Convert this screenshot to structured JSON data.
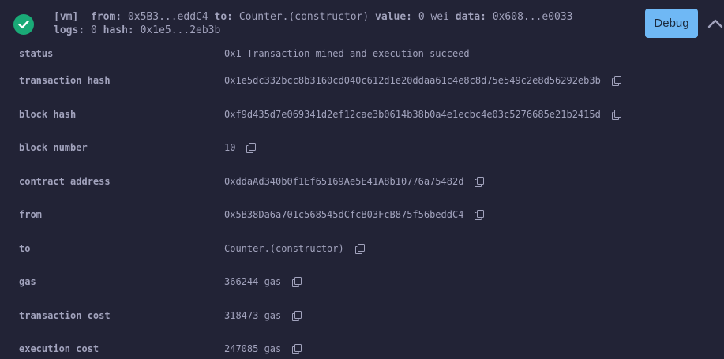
{
  "header": {
    "status_icon": "check-circle-icon",
    "env": "[vm]",
    "from_label": "from:",
    "from_value": "0x5B3...eddC4",
    "to_label": "to:",
    "to_value": "Counter.(constructor)",
    "value_label": "value:",
    "value_value": "0 wei",
    "data_label": "data:",
    "data_value": "0x608...e0033",
    "logs_label": "logs:",
    "logs_value": "0",
    "hash_label": "hash:",
    "hash_value": "0x1e5...2eb3b",
    "debug_label": "Debug",
    "collapse_icon": "chevron-up-icon"
  },
  "rows": [
    {
      "label": "status",
      "value": "0x1 Transaction mined and execution succeed",
      "copy": false
    },
    {
      "label": "transaction hash",
      "value": "0x1e5dc332bcc8b3160cd040c612d1e20ddaa61c4e8c8d75e549c2e8d56292eb3b",
      "copy": true
    },
    {
      "label": "block hash",
      "value": "0xf9d435d7e069341d2ef12cae3b0614b38b0a4e1ecbc4e03c5276685e21b2415d",
      "copy": true
    },
    {
      "label": "block number",
      "value": "10",
      "copy": true
    },
    {
      "label": "contract address",
      "value": "0xddaAd340b0f1Ef65169Ae5E41A8b10776a75482d",
      "copy": true
    },
    {
      "label": "from",
      "value": "0x5B38Da6a701c568545dCfcB03FcB875f56beddC4",
      "copy": true
    },
    {
      "label": "to",
      "value": "Counter.(constructor)",
      "copy": true
    },
    {
      "label": "gas",
      "value": "366244 gas",
      "copy": true
    },
    {
      "label": "transaction cost",
      "value": "318473 gas",
      "copy": true
    },
    {
      "label": "execution cost",
      "value": "247085 gas",
      "copy": true
    }
  ],
  "colors": {
    "background": "#222336",
    "text": "#a2a3bd",
    "success": "#1aaa77",
    "debug_button": "#6fb8f5"
  }
}
